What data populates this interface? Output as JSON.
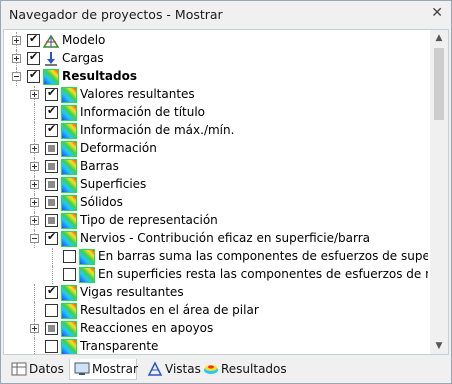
{
  "window": {
    "title": "Navegador de proyectos - Mostrar",
    "close_label": "✕"
  },
  "tree": [
    {
      "label": "Modelo",
      "bold": false,
      "check": "checked",
      "expander": "plus",
      "level": 0,
      "icon": "model-icon"
    },
    {
      "label": "Cargas",
      "bold": false,
      "check": "checked",
      "expander": "plus",
      "level": 0,
      "icon": "loads-icon"
    },
    {
      "label": "Resultados",
      "bold": true,
      "check": "checked",
      "expander": "minus",
      "level": 0,
      "icon": "results-icon"
    },
    {
      "label": "Valores resultantes",
      "bold": false,
      "check": "checked",
      "expander": "plus",
      "level": 1,
      "icon": "results-icon"
    },
    {
      "label": "Información de título",
      "bold": false,
      "check": "checked",
      "expander": "none",
      "level": 1,
      "icon": "results-icon"
    },
    {
      "label": "Información de máx./mín.",
      "bold": false,
      "check": "checked",
      "expander": "none",
      "level": 1,
      "icon": "results-icon"
    },
    {
      "label": "Deformación",
      "bold": false,
      "check": "partial",
      "expander": "plus",
      "level": 1,
      "icon": "results-icon"
    },
    {
      "label": "Barras",
      "bold": false,
      "check": "partial",
      "expander": "plus",
      "level": 1,
      "icon": "results-icon"
    },
    {
      "label": "Superficies",
      "bold": false,
      "check": "partial",
      "expander": "plus",
      "level": 1,
      "icon": "results-icon"
    },
    {
      "label": "Sólidos",
      "bold": false,
      "check": "partial",
      "expander": "plus",
      "level": 1,
      "icon": "results-icon"
    },
    {
      "label": "Tipo de representación",
      "bold": false,
      "check": "partial",
      "expander": "plus",
      "level": 1,
      "icon": "results-icon"
    },
    {
      "label": "Nervios - Contribución eficaz en superficie/barra",
      "bold": false,
      "check": "checked",
      "expander": "minus",
      "level": 1,
      "icon": "results-icon"
    },
    {
      "label": "En barras suma las componentes de esfuerzos de superficies",
      "bold": false,
      "check": "unchecked",
      "expander": "none",
      "level": 2,
      "icon": "results-icon"
    },
    {
      "label": "En superficies resta las componentes de esfuerzos de nervios",
      "bold": false,
      "check": "unchecked",
      "expander": "none",
      "level": 2,
      "icon": "results-icon"
    },
    {
      "label": "Vigas resultantes",
      "bold": false,
      "check": "checked",
      "expander": "none",
      "level": 1,
      "icon": "results-icon"
    },
    {
      "label": "Resultados en el área de pilar",
      "bold": false,
      "check": "unchecked",
      "expander": "none",
      "level": 1,
      "icon": "results-icon"
    },
    {
      "label": "Reacciones en apoyos",
      "bold": false,
      "check": "partial",
      "expander": "plus",
      "level": 1,
      "icon": "results-icon"
    },
    {
      "label": "Transparente",
      "bold": false,
      "check": "unchecked",
      "expander": "none",
      "level": 1,
      "icon": "results-icon"
    }
  ],
  "tabs": [
    {
      "label": "Datos",
      "icon": "data-icon",
      "active": false
    },
    {
      "label": "Mostrar",
      "icon": "display-icon",
      "active": true
    },
    {
      "label": "Vistas",
      "icon": "views-icon",
      "active": false
    },
    {
      "label": "Resultados",
      "icon": "results-tab-icon",
      "active": false
    }
  ]
}
